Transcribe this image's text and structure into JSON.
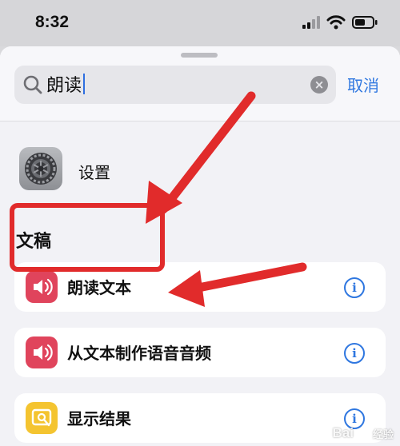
{
  "status_bar": {
    "time": "8:32"
  },
  "search": {
    "query": "朗读",
    "cancel_label": "取消"
  },
  "app_result": {
    "label": "设置",
    "icon": "gear-icon"
  },
  "section": {
    "title": "文稿"
  },
  "actions": [
    {
      "label": "朗读文本",
      "icon": "speaker-icon",
      "color": "#e0445c"
    },
    {
      "label": "从文本制作语音音频",
      "icon": "speaker-icon",
      "color": "#e0445c"
    },
    {
      "label": "显示结果",
      "icon": "result-icon",
      "color": "#f4c430"
    }
  ],
  "annotation_color": "#e12b2b",
  "watermark": {
    "brand": "Bai",
    "suffix": "经验"
  }
}
